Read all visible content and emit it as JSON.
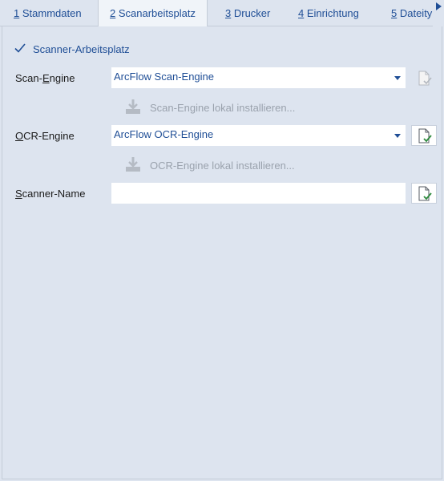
{
  "tabs": [
    {
      "key": "1",
      "label": " Stammdaten"
    },
    {
      "key": "2",
      "label": " Scanarbeitsplatz"
    },
    {
      "key": "3",
      "label": " Drucker"
    },
    {
      "key": "4",
      "label": " Einrichtung"
    },
    {
      "key": "5",
      "label": " Dateityp"
    }
  ],
  "active_tab": "2",
  "scanner_checkbox": {
    "label": "Scanner-Arbeitsplatz",
    "checked": true
  },
  "scan_engine": {
    "label_pre": "Scan-",
    "label_key": "E",
    "label_post": "ngine",
    "value": "ArcFlow Scan-Engine",
    "install_label": "Scan-Engine lokal installieren..."
  },
  "ocr_engine": {
    "label_key": "O",
    "label_post": "CR-Engine",
    "value": "ArcFlow OCR-Engine",
    "install_label": "OCR-Engine lokal installieren..."
  },
  "scanner_name": {
    "label_key": "S",
    "label_post": "canner-Name",
    "value": ""
  },
  "icons": {
    "check": "checkmark-icon",
    "document_check": "document-check-icon",
    "download": "download-icon",
    "dropdown": "chevron-down-icon",
    "scroll_right": "triangle-right-icon"
  },
  "colors": {
    "accent": "#1f4e96",
    "panel_bg": "#dde4ef",
    "active_tab_bg": "#f0f4f9",
    "disabled_text": "#9aa2ad",
    "check_green": "#2e8b3e"
  }
}
